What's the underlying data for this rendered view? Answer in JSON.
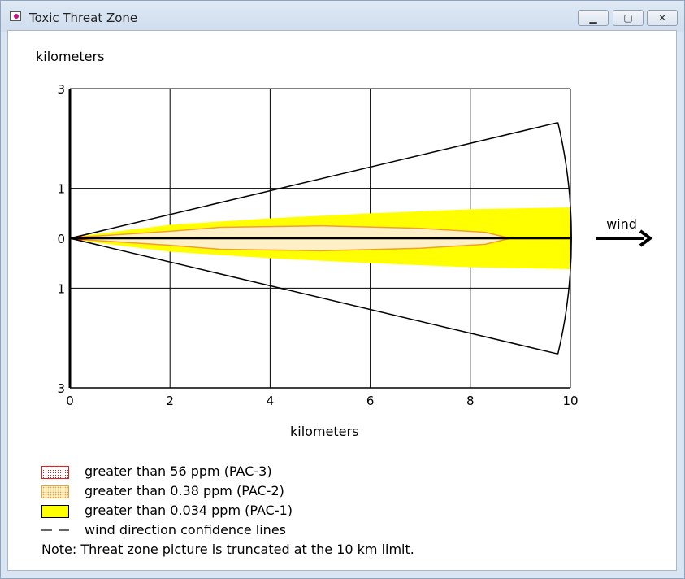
{
  "window": {
    "title": "Toxic Threat Zone",
    "buttons": {
      "minimize": "▁",
      "restore": "▢",
      "close": "✕"
    }
  },
  "chart_data": {
    "type": "area",
    "xlabel": "kilometers",
    "ylabel": "kilometers",
    "xlim": [
      0,
      10
    ],
    "ylim": [
      -3,
      3
    ],
    "x_ticks": [
      0,
      2,
      4,
      6,
      8,
      10
    ],
    "y_ticks": [
      {
        "value": 3,
        "label": "3"
      },
      {
        "value": 1,
        "label": "1"
      },
      {
        "value": 0,
        "label": "0"
      },
      {
        "value": -1,
        "label": "1"
      },
      {
        "value": -3,
        "label": "3"
      }
    ],
    "grid": true,
    "wind_label": "wind",
    "zones": [
      {
        "name": "greater than 0.034 ppm (PAC-1)",
        "color": "#ffff00",
        "upper": [
          [
            0,
            0.02
          ],
          [
            2,
            0.27
          ],
          [
            4,
            0.4
          ],
          [
            6,
            0.5
          ],
          [
            8,
            0.58
          ],
          [
            10,
            0.62
          ]
        ],
        "lower": [
          [
            0,
            -0.02
          ],
          [
            2,
            -0.27
          ],
          [
            4,
            -0.4
          ],
          [
            6,
            -0.5
          ],
          [
            8,
            -0.58
          ],
          [
            10,
            -0.62
          ]
        ]
      },
      {
        "name": "greater than 0.38 ppm (PAC-2)",
        "color": "#fff0c8",
        "upper": [
          [
            0,
            0.01
          ],
          [
            2,
            0.14
          ],
          [
            3,
            0.22
          ],
          [
            5,
            0.25
          ],
          [
            7,
            0.2
          ],
          [
            8.3,
            0.12
          ],
          [
            8.8,
            0
          ]
        ],
        "lower": [
          [
            0,
            -0.01
          ],
          [
            2,
            -0.14
          ],
          [
            3,
            -0.22
          ],
          [
            5,
            -0.25
          ],
          [
            7,
            -0.2
          ],
          [
            8.3,
            -0.12
          ],
          [
            8.8,
            0
          ]
        ]
      },
      {
        "name": "greater than 56 ppm (PAC-3)",
        "color": "#e0201a",
        "upper": [
          [
            0,
            0.01
          ],
          [
            0.2,
            0.04
          ],
          [
            0.5,
            0
          ]
        ],
        "lower": [
          [
            0,
            -0.01
          ],
          [
            0.2,
            -0.04
          ],
          [
            0.5,
            0
          ]
        ]
      }
    ],
    "confidence_lines": {
      "upper": [
        [
          0,
          0
        ],
        [
          9.75,
          2.32
        ]
      ],
      "lower": [
        [
          0,
          0
        ],
        [
          9.75,
          -2.32
        ]
      ],
      "arc_center_x": 0
    },
    "centerline": [
      [
        0,
        0
      ],
      [
        10,
        0
      ]
    ]
  },
  "legend": [
    {
      "key": "pac3",
      "label": "greater than 56 ppm (PAC-3)"
    },
    {
      "key": "pac2",
      "label": "greater than 0.38 ppm (PAC-2)"
    },
    {
      "key": "pac1",
      "label": "greater than 0.034 ppm (PAC-1)"
    },
    {
      "key": "lines",
      "label": "wind direction confidence lines"
    }
  ],
  "note": "Note: Threat zone picture is truncated at the 10 km limit."
}
